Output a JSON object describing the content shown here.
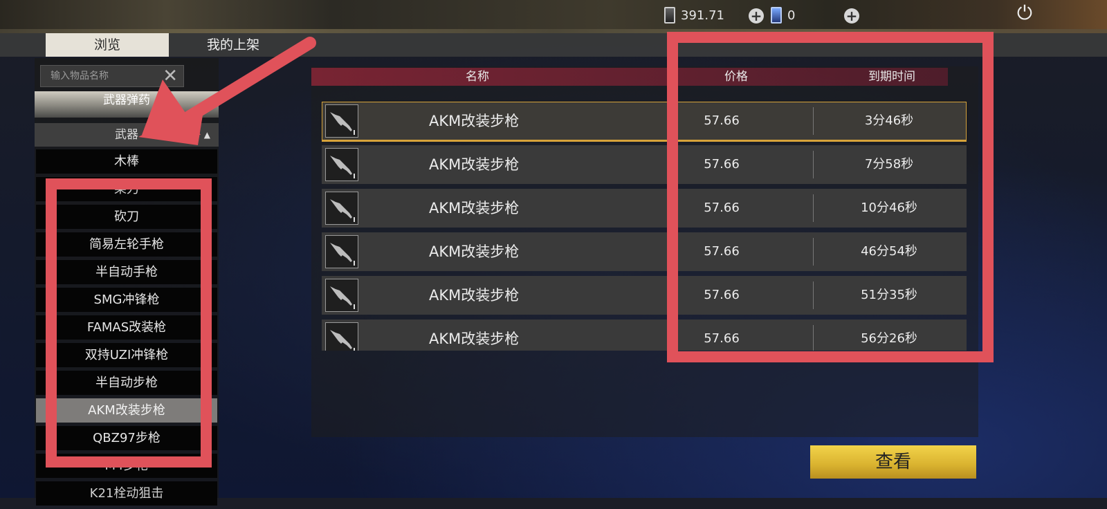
{
  "header": {
    "currency_1": "391.71",
    "currency_2": "0"
  },
  "tabs": [
    {
      "label": "浏览",
      "active": true
    },
    {
      "label": "我的上架",
      "active": false
    }
  ],
  "sidebar": {
    "search_placeholder": "输入物品名称",
    "category": "武器弹药",
    "subcategory": "武器",
    "items": [
      {
        "label": "木棒"
      },
      {
        "label": "柴刀"
      },
      {
        "label": "砍刀"
      },
      {
        "label": "简易左轮手枪"
      },
      {
        "label": "半自动手枪"
      },
      {
        "label": "SMG冲锋枪"
      },
      {
        "label": "FAMAS改装枪"
      },
      {
        "label": "双持UZI冲锋枪"
      },
      {
        "label": "半自动步枪"
      },
      {
        "label": "AKM改装步枪",
        "selected": true
      },
      {
        "label": "QBZ97步枪"
      },
      {
        "label": "M4步枪"
      },
      {
        "label": "K21栓动狙击"
      }
    ]
  },
  "table": {
    "headers": {
      "name": "名称",
      "price": "价格",
      "expiry": "到期时间"
    },
    "rows": [
      {
        "name": "AKM改装步枪",
        "price": "57.66",
        "expiry": "3分46秒"
      },
      {
        "name": "AKM改装步枪",
        "price": "57.66",
        "expiry": "7分58秒"
      },
      {
        "name": "AKM改装步枪",
        "price": "57.66",
        "expiry": "10分46秒"
      },
      {
        "name": "AKM改装步枪",
        "price": "57.66",
        "expiry": "46分54秒"
      },
      {
        "name": "AKM改装步枪",
        "price": "57.66",
        "expiry": "51分35秒"
      },
      {
        "name": "AKM改装步枪",
        "price": "57.66",
        "expiry": "56分26秒"
      }
    ]
  },
  "actions": {
    "view_label": "查看"
  },
  "colors": {
    "annotation": "#e0525a",
    "highlight": "#d7a33a",
    "button": "#e2c13c"
  },
  "icons": {
    "currency_1": "silver-coin-icon",
    "currency_2": "blue-gem-icon",
    "plus": "plus-icon",
    "power": "power-icon",
    "clear": "close-icon",
    "expand": "triangle-up-icon",
    "weapon": "rifle-icon"
  }
}
